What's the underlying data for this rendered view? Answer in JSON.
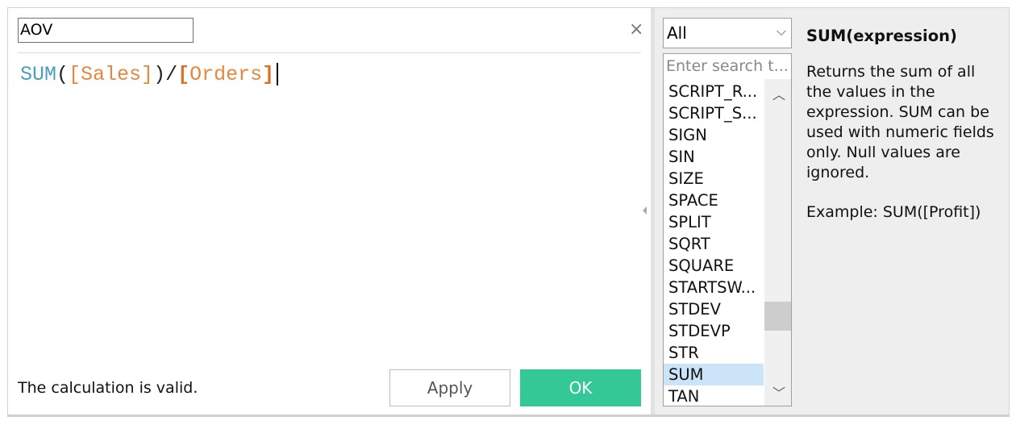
{
  "calc_name": "AOV",
  "formula": {
    "fn": "SUM",
    "open": "(",
    "field1": "[Sales]",
    "close": ")",
    "op": "/",
    "field2_open": "[",
    "field2": "Orders",
    "field2_close": "]"
  },
  "status": "The calculation is valid.",
  "buttons": {
    "apply": "Apply",
    "ok": "OK",
    "close": "×"
  },
  "colors": {
    "ok": "#33c896",
    "function": "#4aa0bd",
    "field": "#e5873f",
    "selected": "#cce4f7"
  },
  "category_select": {
    "value": "All",
    "chevron": "⌵"
  },
  "search": {
    "placeholder": "Enter search t..."
  },
  "functions": [
    "SCRIPT_R...",
    "SCRIPT_S...",
    "SIGN",
    "SIN",
    "SIZE",
    "SPACE",
    "SPLIT",
    "SQRT",
    "SQUARE",
    "STARTSW...",
    "STDEV",
    "STDEVP",
    "STR",
    "SUM",
    "TAN"
  ],
  "selected_function": "SUM",
  "help": {
    "title": "SUM(expression)",
    "description": "Returns the sum of all the values in the expression. SUM can be used with numeric fields only. Null values are ignored.",
    "example": "Example: SUM([Profit])"
  }
}
